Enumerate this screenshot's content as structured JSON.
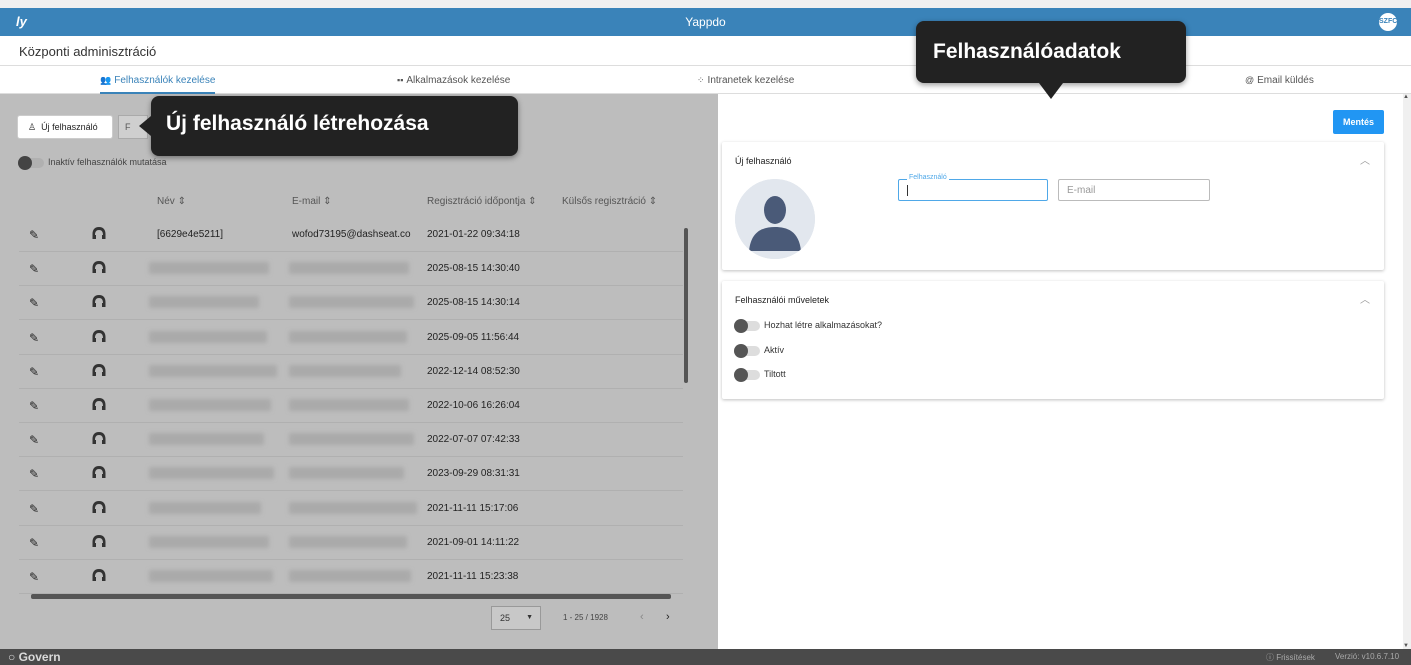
{
  "app": {
    "logo": "ly",
    "title": "Yappdo",
    "user_initials": "SZFC"
  },
  "header": {
    "title": "Központi adminisztráció"
  },
  "tabs": [
    {
      "icon": "users-icon",
      "label": "Felhasználók kezelése",
      "active": true
    },
    {
      "icon": "grid-icon",
      "label": "Alkalmazások kezelése",
      "active": false
    },
    {
      "icon": "network-icon",
      "label": "Intranetek kezelése",
      "active": false
    },
    {
      "icon": "partial-icon",
      "label": "",
      "active": false
    },
    {
      "icon": "at-icon",
      "label": "Email küldés",
      "active": false
    }
  ],
  "users": {
    "new_button_label": "Új felhasználó",
    "second_button_label": "F",
    "inactive_toggle_label": "Inaktív felhasználók mutatása",
    "columns": [
      "Név",
      "E-mail",
      "Regisztráció időpontja",
      "Külsős regisztráció"
    ],
    "sort_glyph": "⇕",
    "rows": [
      {
        "name": "[6629e4e5211]",
        "email": "wofod73195@dashseat.co",
        "registered": "2021-01-22 09:34:18"
      },
      {
        "name": "",
        "email": "",
        "registered": "2025-08-15 14:30:40"
      },
      {
        "name": "",
        "email": "",
        "registered": "2025-08-15 14:30:14"
      },
      {
        "name": "",
        "email": "",
        "registered": "2025-09-05 11:56:44"
      },
      {
        "name": "",
        "email": "",
        "registered": "2022-12-14 08:52:30"
      },
      {
        "name": "",
        "email": "",
        "registered": "2022-10-06 16:26:04"
      },
      {
        "name": "",
        "email": "",
        "registered": "2022-07-07 07:42:33"
      },
      {
        "name": "",
        "email": "",
        "registered": "2023-09-29 08:31:31"
      },
      {
        "name": "",
        "email": "",
        "registered": "2021-11-11 15:17:06"
      },
      {
        "name": "",
        "email": "",
        "registered": "2021-09-01 14:11:22"
      },
      {
        "name": "",
        "email": "",
        "registered": "2021-11-11 15:23:38"
      }
    ],
    "pager": {
      "page_size": "25",
      "range": "1 - 25 / 1928",
      "prev": "‹",
      "next": "›"
    }
  },
  "detail": {
    "save_label": "Mentés",
    "new_user_card_title": "Új felhasználó",
    "username_float_label": "Felhasználó",
    "email_placeholder": "E-mail",
    "actions_card_title": "Felhasználói műveletek",
    "permissions": [
      "Hozhat létre alkalmazásokat?",
      "Aktív",
      "Tiltott"
    ]
  },
  "tooltips": {
    "new_user": "Új felhasználó létrehozása",
    "user_data": "Felhasználóadatok"
  },
  "footer": {
    "brand": "○ Govern",
    "updates": "ⓘ Frissítések",
    "version": "Verzió: v10.6.7.10"
  },
  "colors": {
    "primary": "#3a83b9",
    "save_button": "#2196f3",
    "tooltip_bg": "#222222",
    "footer_bg": "#4a4a4a"
  }
}
